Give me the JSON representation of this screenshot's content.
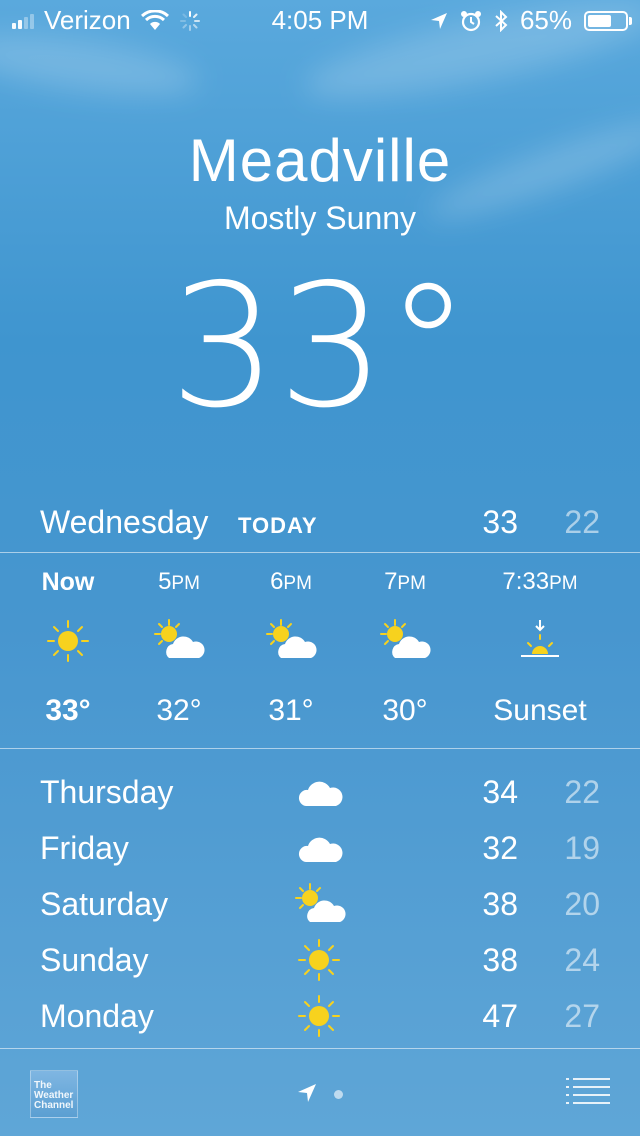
{
  "status_bar": {
    "carrier": "Verizon",
    "time": "4:05 PM",
    "battery_percent": "65%",
    "battery_level": 0.65,
    "icons": [
      "signal-icon",
      "wifi-icon",
      "activity-spinner-icon",
      "location-icon",
      "alarm-icon",
      "bluetooth-icon",
      "battery-icon"
    ]
  },
  "location": {
    "city": "Meadville",
    "condition": "Mostly Sunny",
    "temperature": "33°"
  },
  "today": {
    "day": "Wednesday",
    "badge": "TODAY",
    "high": "33",
    "low": "22"
  },
  "hourly": [
    {
      "time": "Now",
      "icon": "sun-icon",
      "temp": "33°"
    },
    {
      "time": "5PM",
      "icon": "partly-cloudy-icon",
      "temp": "32°"
    },
    {
      "time": "6PM",
      "icon": "partly-cloudy-icon",
      "temp": "31°"
    },
    {
      "time": "7PM",
      "icon": "partly-cloudy-icon",
      "temp": "30°"
    },
    {
      "time": "7:33PM",
      "icon": "sunset-icon",
      "temp": "Sunset"
    }
  ],
  "daily": [
    {
      "day": "Thursday",
      "icon": "cloud-icon",
      "high": "34",
      "low": "22"
    },
    {
      "day": "Friday",
      "icon": "cloud-icon",
      "high": "32",
      "low": "19"
    },
    {
      "day": "Saturday",
      "icon": "partly-cloudy-icon",
      "high": "38",
      "low": "20"
    },
    {
      "day": "Sunday",
      "icon": "sun-icon",
      "high": "38",
      "low": "24"
    },
    {
      "day": "Monday",
      "icon": "sun-icon",
      "high": "47",
      "low": "27"
    }
  ],
  "toolbar": {
    "logo_text": "The Weather Channel",
    "icons": [
      "weather-channel-logo",
      "location-arrow-icon",
      "page-dot",
      "list-icon"
    ]
  },
  "colors": {
    "sky_top": "#5aa9dd",
    "sky_mid": "#3f95cf",
    "sun_yellow": "#f7d21e",
    "cloud_white": "#ffffff"
  }
}
